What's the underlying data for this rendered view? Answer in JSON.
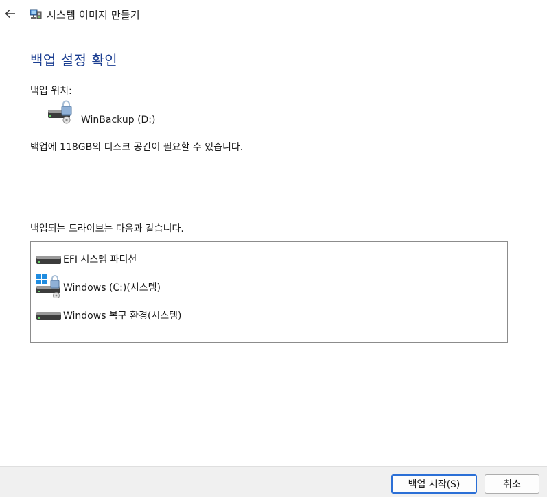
{
  "window": {
    "title": "시스템 이미지 만들기",
    "back_icon": "arrow-left-icon",
    "app_icon": "system-image-backup-icon"
  },
  "main": {
    "heading": "백업 설정 확인",
    "location_label": "백업 위치:",
    "location": {
      "name": "WinBackup (D:)",
      "icon": "drive-locked-icon"
    },
    "space_text": "백업에 118GB의 디스크 공간이 필요할 수 있습니다.",
    "drives_label": "백업되는 드라이브는 다음과 같습니다.",
    "drives": [
      {
        "label": "EFI 시스템 파티션",
        "icon": "drive-icon"
      },
      {
        "label": "Windows (C:)(시스템)",
        "icon": "windows-drive-locked-icon"
      },
      {
        "label": "Windows 복구 환경(시스템)",
        "icon": "drive-icon"
      }
    ]
  },
  "footer": {
    "start_label": "백업 시작(S)",
    "cancel_label": "취소"
  },
  "colors": {
    "heading": "#1a3d91",
    "primary_border": "#2b6fd6",
    "footer_bg": "#f0f0f0"
  }
}
